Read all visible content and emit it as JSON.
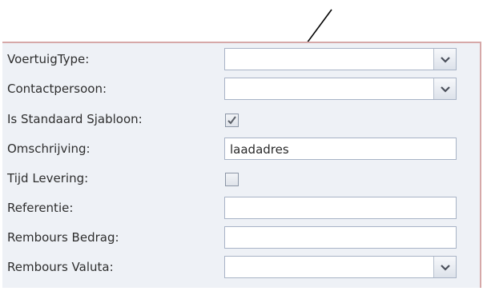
{
  "form": {
    "fields": [
      {
        "label": "VoertuigType:",
        "type": "select",
        "value": ""
      },
      {
        "label": "Contactpersoon:",
        "type": "select",
        "value": ""
      },
      {
        "label": "Is Standaard Sjabloon:",
        "type": "checkbox",
        "checked": true
      },
      {
        "label": "Omschrijving:",
        "type": "text",
        "value": "laadadres"
      },
      {
        "label": "Tijd Levering:",
        "type": "checkbox",
        "checked": false
      },
      {
        "label": "Referentie:",
        "type": "text",
        "value": ""
      },
      {
        "label": "Rembours Bedrag:",
        "type": "text",
        "value": ""
      },
      {
        "label": "Rembours Valuta:",
        "type": "select",
        "value": ""
      }
    ]
  },
  "annotation": {
    "icon": "arrow-icon",
    "points_to": "is-standaard-sjabloon-checkbox"
  },
  "colors": {
    "panel_background": "#eef1f6",
    "panel_border": "#d6a8a8",
    "field_border": "#a8b3c6",
    "annotation_arrow": "#000000"
  }
}
